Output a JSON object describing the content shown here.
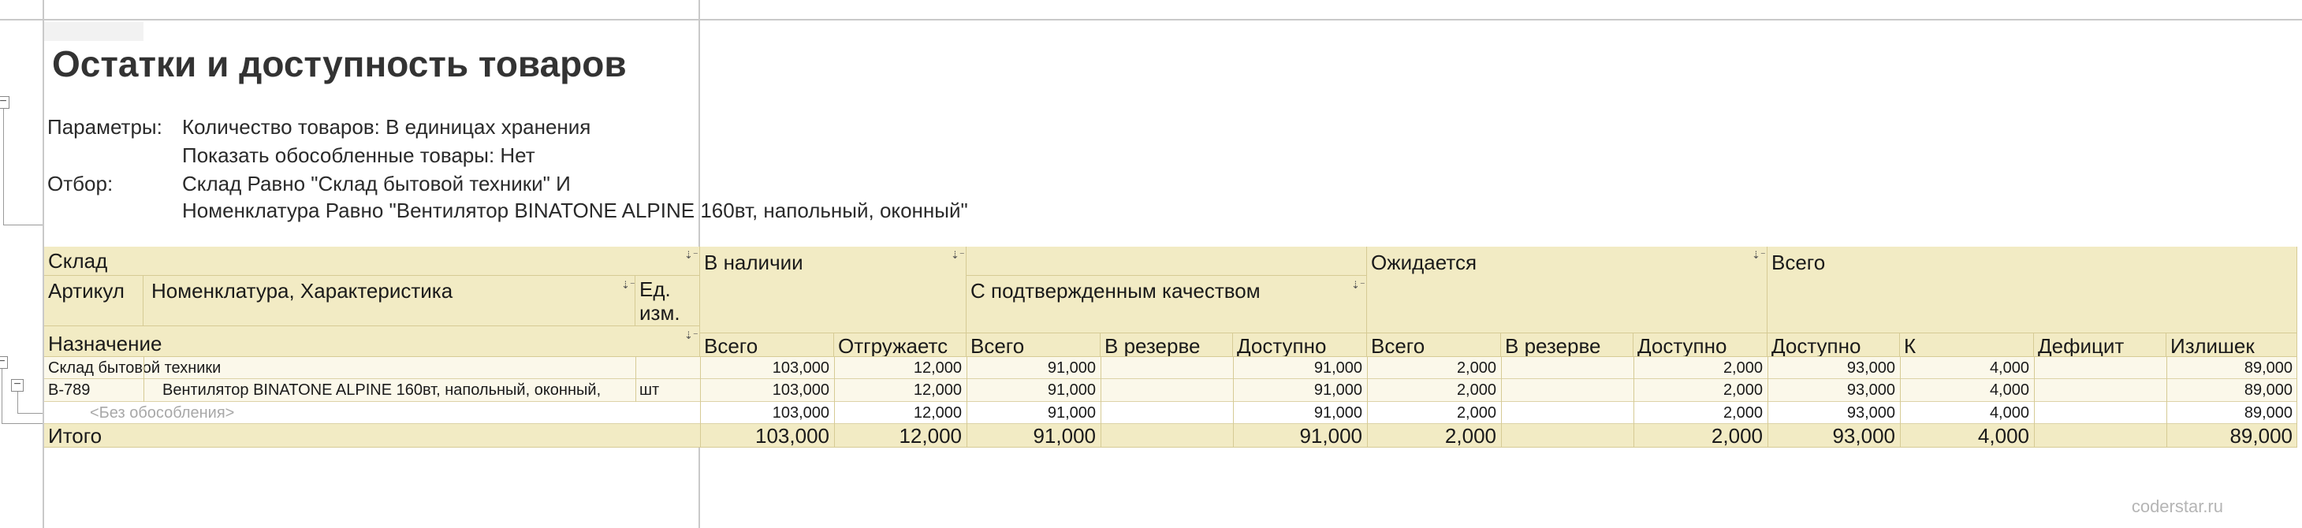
{
  "report": {
    "title": "Остатки и доступность товаров",
    "params_label": "Параметры:",
    "param_1": "Количество товаров: В единицах хранения",
    "param_2": "Показать обособленные товары: Нет",
    "filter_label": "Отбор:",
    "filter_1": "Склад Равно \"Склад бытовой техники\" И",
    "filter_2": "Номенклатура Равно \"Вентилятор BINATONE ALPINE 160вт, напольный, оконный\""
  },
  "header": {
    "warehouse": "Склад",
    "article": "Артикул",
    "nomenclature": "Номенклатура, Характеристика",
    "unit_line1": "Ед.",
    "unit_line2": "изм.",
    "purpose": "Назначение",
    "in_stock": "В наличии",
    "confirmed_quality": "С подтвержденным качеством",
    "expected": "Ожидается",
    "total": "Всего",
    "cols": [
      "Всего",
      "Отгружаетс",
      "Всего",
      "В резерве",
      "Доступно",
      "Всего",
      "В резерве",
      "Доступно",
      "Доступно",
      "К",
      "Дефицит",
      "Излишек"
    ]
  },
  "rows": {
    "group": {
      "label": "Склад бытовой техники",
      "values": [
        "103,000",
        "12,000",
        "91,000",
        "",
        "91,000",
        "2,000",
        "",
        "2,000",
        "93,000",
        "4,000",
        "",
        "89,000"
      ]
    },
    "item": {
      "article": "В-789",
      "name": "Вентилятор BINATONE ALPINE 160вт, напольный, оконный,",
      "unit": "шт",
      "values": [
        "103,000",
        "12,000",
        "91,000",
        "",
        "91,000",
        "2,000",
        "",
        "2,000",
        "93,000",
        "4,000",
        "",
        "89,000"
      ]
    },
    "sub": {
      "label": "<Без обособления>",
      "values": [
        "103,000",
        "12,000",
        "91,000",
        "",
        "91,000",
        "2,000",
        "",
        "2,000",
        "93,000",
        "4,000",
        "",
        "89,000"
      ]
    },
    "total": {
      "label": "Итого",
      "values": [
        "103,000",
        "12,000",
        "91,000",
        "",
        "91,000",
        "2,000",
        "",
        "2,000",
        "93,000",
        "4,000",
        "",
        "89,000"
      ]
    }
  },
  "icons": {
    "sort": "sort-icon",
    "collapse": "tree-collapse-icon"
  },
  "colors": {
    "header_bg": "#f2ebc4",
    "row_bg": "#fbf8ea",
    "grid": "#d6cb95"
  },
  "watermark": "coderstar.ru"
}
